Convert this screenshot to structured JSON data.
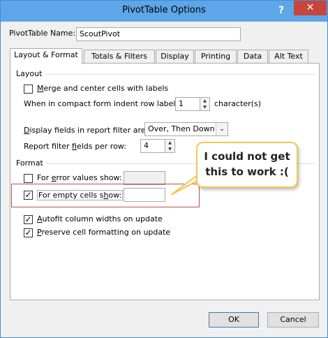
{
  "window": {
    "title": "PivotTable Options"
  },
  "controls": {
    "help": "?",
    "close": "✕"
  },
  "pivot_name": {
    "label": "PivotTable Name:",
    "value": "ScoutPivot"
  },
  "tabs": [
    {
      "label": "Layout & Format",
      "active": true
    },
    {
      "label": "Totals & Filters",
      "active": false
    },
    {
      "label": "Display",
      "active": false
    },
    {
      "label": "Printing",
      "active": false
    },
    {
      "label": "Data",
      "active": false
    },
    {
      "label": "Alt Text",
      "active": false
    }
  ],
  "layout_group": {
    "title": "Layout",
    "merge_label": "Merge and center cells with labels",
    "merge_checked": false,
    "indent_label": "When in compact form indent row labels:",
    "indent_value": "1",
    "indent_unit": "character(s)",
    "display_filter_label": "Display fields in report filter area:",
    "display_filter_value": "Over, Then Down",
    "fields_per_row_label": "Report filter fields per row:",
    "fields_per_row_value": "4"
  },
  "format_group": {
    "title": "Format",
    "error_label": "For error values show:",
    "error_checked": false,
    "error_value": "",
    "empty_label": "For empty cells show:",
    "empty_checked": true,
    "empty_value": "",
    "autofit_label": "Autofit column widths on update",
    "autofit_checked": true,
    "preserve_label": "Preserve cell formatting on update",
    "preserve_checked": true
  },
  "callout": {
    "text": "I could not get this to work :("
  },
  "buttons": {
    "ok": "OK",
    "cancel": "Cancel"
  },
  "glyphs": {
    "check": "✓",
    "up": "▲",
    "down": "▼",
    "dropdown": "⌄"
  }
}
